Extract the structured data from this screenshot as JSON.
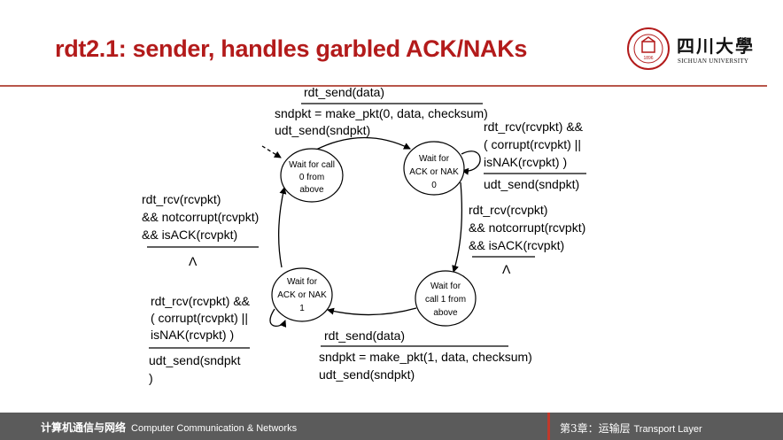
{
  "slide": {
    "title": "rdt2.1: sender, handles garbled ACK/NAKs"
  },
  "logo": {
    "seal_text": "1896",
    "cn_name": "四川大學",
    "en_name": "SICHUAN UNIVERSITY"
  },
  "fsm": {
    "states": {
      "wait_call_0": [
        "Wait for call",
        "0 from",
        "above"
      ],
      "wait_ack_0": [
        "Wait for",
        "ACK or NAK",
        "0"
      ],
      "wait_call_1": [
        "Wait for",
        "call 1 from",
        "above"
      ],
      "wait_ack_1": [
        "Wait for",
        "ACK or NAK",
        "1"
      ]
    },
    "transitions": {
      "send_0": {
        "event": "rdt_send(data)",
        "actions": [
          "sndpkt = make_pkt(0, data, checksum)",
          "udt_send(sndpkt)"
        ]
      },
      "retransmit_0": {
        "event": [
          "rdt_rcv(rcvpkt) &&",
          "( corrupt(rcvpkt) ||",
          "isNAK(rcvpkt) )"
        ],
        "action": "udt_send(sndpkt)"
      },
      "ack_0": {
        "event": [
          "rdt_rcv(rcvpkt)",
          "&& notcorrupt(rcvpkt)",
          "&& isACK(rcvpkt)"
        ],
        "action": "Λ"
      },
      "send_1": {
        "event": "rdt_send(data)",
        "actions": [
          "sndpkt = make_pkt(1, data, checksum)",
          "udt_send(sndpkt)"
        ]
      },
      "retransmit_1": {
        "event": [
          "rdt_rcv(rcvpkt) &&",
          "( corrupt(rcvpkt) ||",
          "isNAK(rcvpkt) )"
        ],
        "action": [
          "udt_send(sndpkt",
          ")"
        ]
      },
      "ack_1": {
        "event": [
          "rdt_rcv(rcvpkt)",
          "&& notcorrupt(rcvpkt)",
          "&& isACK(rcvpkt)"
        ],
        "action": "Λ"
      }
    }
  },
  "footer": {
    "left_cn": "计算机通信与网络",
    "left_en": "Computer Communication & Networks",
    "right_cn": "第3章：运输层",
    "right_en": "Transport Layer"
  },
  "colors": {
    "title": "#b31b1b",
    "rule": "#b8564a",
    "footer_bg": "#5b5b5b",
    "footer_accent": "#c0392b"
  }
}
